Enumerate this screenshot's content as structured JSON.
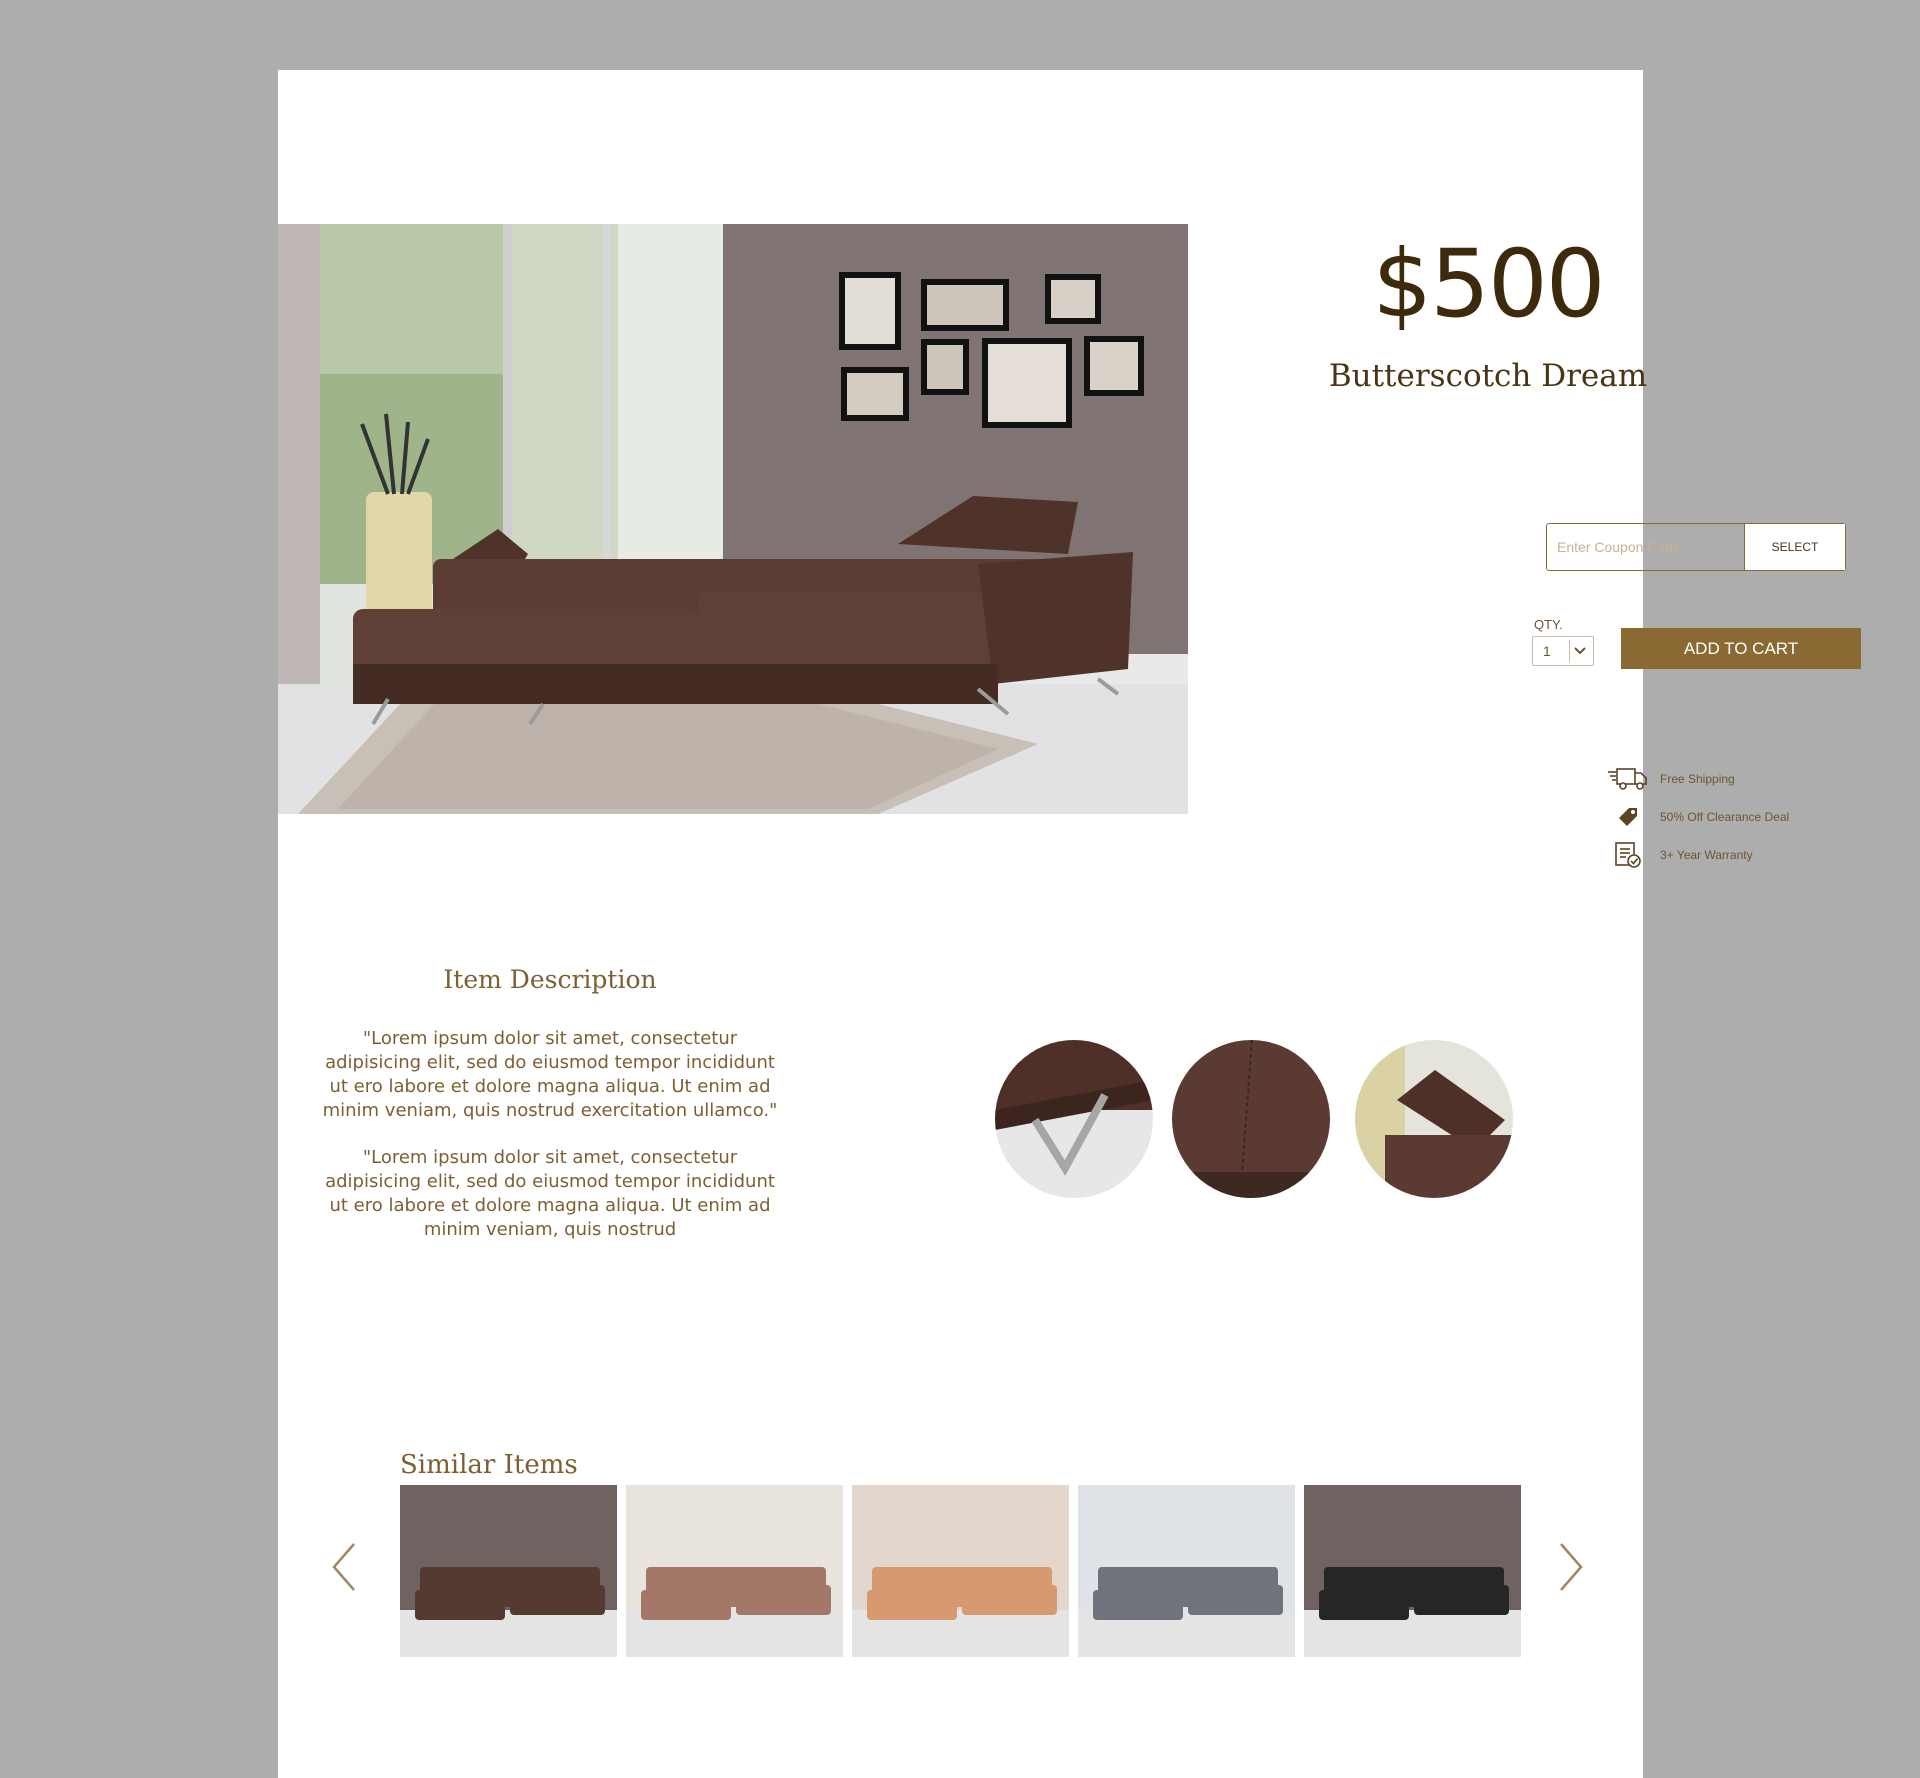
{
  "product": {
    "price": "$500",
    "name": "Butterscotch Dream"
  },
  "coupon": {
    "placeholder": "Enter Coupon Code",
    "button_label": "SELECT"
  },
  "quantity": {
    "label": "QTY.",
    "value": "1"
  },
  "cart": {
    "button_label": "ADD TO CART"
  },
  "perks": [
    {
      "icon": "truck-icon",
      "label": "Free Shipping"
    },
    {
      "icon": "price-tag-icon",
      "label": "50% Off Clearance Deal"
    },
    {
      "icon": "warranty-certificate-icon",
      "label": "3+ Year Warranty"
    }
  ],
  "description": {
    "title": "Item Description",
    "paragraphs": [
      "\"Lorem ipsum dolor sit amet, consectetur adipisicing elit, sed do eiusmod tempor incididunt ut ero labore et dolore magna aliqua. Ut enim ad minim veniam, quis nostrud exercitation ullamco.\"",
      "\"Lorem ipsum dolor sit amet, consectetur adipisicing elit, sed do eiusmod tempor incididunt ut ero labore et dolore magna aliqua. Ut enim ad minim veniam, quis nostrud"
    ]
  },
  "similar": {
    "title": "Similar Items",
    "items": [
      {
        "sofa_color": "#553a31",
        "wall_color": "#6f6260"
      },
      {
        "sofa_color": "#a47868",
        "wall_color": "#e9e3dd"
      },
      {
        "sofa_color": "#d79a70",
        "wall_color": "#e3d6cc"
      },
      {
        "sofa_color": "#6e737c",
        "wall_color": "#dfe3e8"
      },
      {
        "sofa_color": "#262626",
        "wall_color": "#6f6260"
      }
    ]
  },
  "colors": {
    "accent": "#8a6a32",
    "text_dark": "#3d2a0c",
    "text_brown": "#7d5f32",
    "page_bg": "#adadad"
  }
}
